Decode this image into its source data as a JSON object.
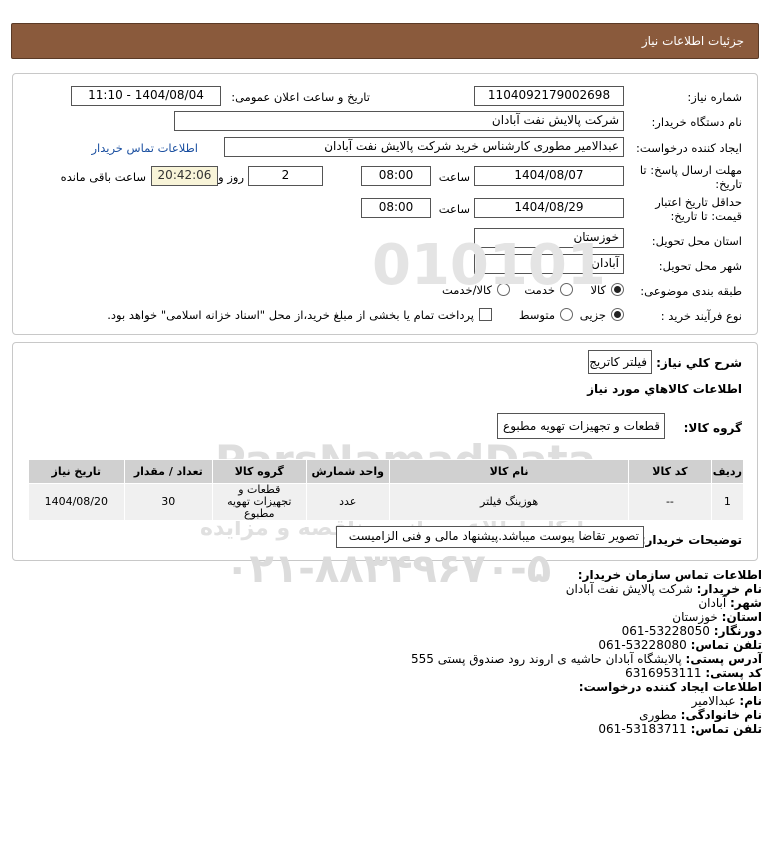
{
  "header": {
    "title": "جزئیات اطلاعات نیاز"
  },
  "form": {
    "need_number": {
      "label": "شماره نیاز:",
      "value": "1104092179002698"
    },
    "announce_datetime": {
      "label": "تاریخ و ساعت اعلان عمومی:",
      "value": "1404/08/04 - 11:10"
    },
    "buyer_org": {
      "label": "نام دستگاه خریدار:",
      "value": "شرکت پالایش نفت آبادان"
    },
    "requester": {
      "label": "ایجاد کننده درخواست:",
      "value": "عبدالامیر مطوری کارشناس خرید  شرکت پالایش نفت آبادان",
      "contact_link": "اطلاعات تماس خریدار"
    },
    "reply_deadline": {
      "label_line1": "مهلت ارسال پاسخ: تا",
      "label_line2": "تاریخ:",
      "date": "1404/08/07",
      "time_label": "ساعت",
      "time": "08:00",
      "days": "2",
      "days_label": "روز و",
      "remaining": "20:42:06",
      "remaining_label": "ساعت باقی مانده"
    },
    "price_validity": {
      "label_line1": "حداقل تاریخ اعتبار",
      "label_line2": "قیمت: تا تاریخ:",
      "date": "1404/08/29",
      "time_label": "ساعت",
      "time": "08:00"
    },
    "province": {
      "label": "استان محل تحویل:",
      "value": "خوزستان"
    },
    "city": {
      "label": "شهر محل تحویل:",
      "value": "آبادان"
    },
    "category": {
      "label": "طبقه بندی موضوعی:",
      "options": [
        "کالا",
        "خدمت",
        "کالا/خدمت"
      ],
      "selected": "کالا"
    },
    "process": {
      "label": "نوع فرآیند خرید :",
      "options": [
        "جزیی",
        "متوسط"
      ],
      "selected": "جزیی",
      "treasury_note": "پرداخت تمام یا بخشی از مبلغ خرید،از محل \"اسناد خزانه اسلامی\" خواهد بود."
    }
  },
  "needs": {
    "summary_label": "شرح كلي نياز:",
    "summary_value": "فیلتر کاتریج",
    "goods_info_title": "اطلاعات كالاهاي مورد نياز",
    "goods_group_label": "گروه کالا:",
    "goods_group_value": "قطعات و تجهیزات تهویه مطبوع",
    "table": {
      "headers": [
        "ردیف",
        "کد کالا",
        "نام کالا",
        "واحد شمارش",
        "گروه کالا",
        "تعداد / مقدار",
        "تاریخ نیاز"
      ],
      "rows": [
        {
          "row": "1",
          "code": "--",
          "name": "هوزینگ فیلتر",
          "unit": "عدد",
          "group": "قطعات و تجهیزات تهویه مطبوع",
          "qty": "30",
          "date": "1404/08/20"
        }
      ]
    },
    "buyer_notes_label": "توضیحات خریدار:",
    "buyer_notes_value": "تصویر تقاضا پیوست میباشد.پیشنهاد مالی و فنی الزامیست"
  },
  "contact": {
    "org_title": "اطلاعات تماس سازمان خریدار:",
    "buyer_name_label": "نام خریدار:",
    "buyer_name": "شرکت پالایش نفت آبادان",
    "city_label": "شهر:",
    "city": "آبادان",
    "province_label": "استان:",
    "province": "خوزستان",
    "fax_label": "دورنگار:",
    "fax": "53228050-061",
    "phone_label": "تلفن تماس:",
    "phone": "53228080-061",
    "address_label": "آدرس پستی:",
    "address": "پالایشگاه آبادان حاشیه ی اروند رود صندوق پستی 555",
    "postal_label": "کد پستی:",
    "postal": "6316953111",
    "requester_title": "اطلاعات ایجاد کننده درخواست:",
    "first_name_label": "نام:",
    "first_name": "عبدالامیر",
    "last_name_label": "نام خانوادگی:",
    "last_name": "مطوری",
    "req_phone_label": "تلفن تماس:",
    "req_phone": "53183711-061"
  },
  "watermark": {
    "brand": "ParsNamadData",
    "number": "۰۲۱-۸۸۳۴۹۶۷۰-۵",
    "line1": "مرکز فراهم آوری اطلاعات پارس نماد داده",
    "line2": "پایگاه اطلاع رسانی مناقصه و مزایده"
  },
  "colors": {
    "header_bg": "#8a5a3c",
    "table_header": "#d0d0d0",
    "table_row": "#f0f0f0",
    "link": "#1a4fa0"
  }
}
